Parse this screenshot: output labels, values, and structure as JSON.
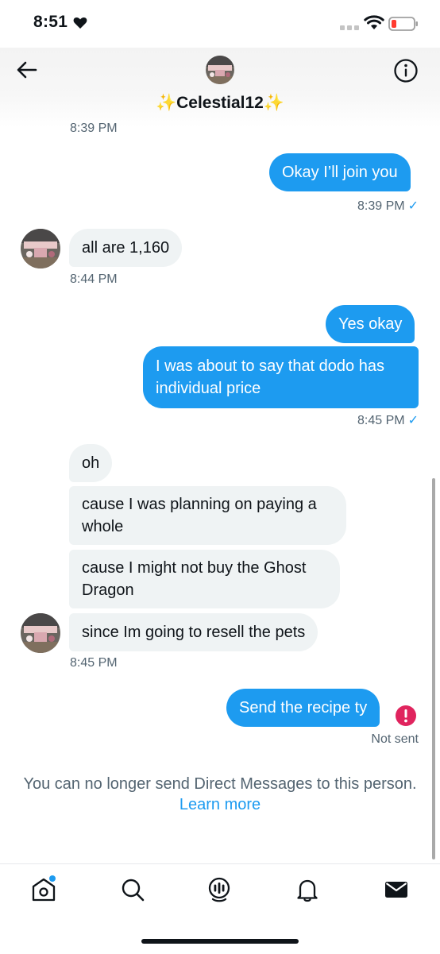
{
  "status_bar": {
    "time": "8:51"
  },
  "header": {
    "name": "✨Celestial12✨"
  },
  "messages": {
    "ts_top": "8:39 PM",
    "m1": {
      "text": "Okay I’ll join you",
      "ts": "8:39 PM"
    },
    "m2": {
      "text": "all are 1,160",
      "ts": "8:44 PM"
    },
    "m3": {
      "text": "Yes okay"
    },
    "m4": {
      "line1": "I was about to say that dodo has",
      "line2": "individual price",
      "ts": "8:45 PM"
    },
    "m5": {
      "text": "oh"
    },
    "m6": {
      "line1": "cause I was planning on paying a",
      "line2": "whole"
    },
    "m7": {
      "line1": "cause I might not buy the Ghost",
      "line2": "Dragon"
    },
    "m8": {
      "text": "since Im going to resell the pets",
      "ts": "8:45 PM"
    },
    "m9": {
      "text": "Send the recipe ty",
      "status": "Not sent"
    }
  },
  "check_mark": "✓",
  "notice": {
    "text": "You can no longer send Direct Messages to this person.",
    "link": "Learn more"
  },
  "tabs": [
    "home-icon",
    "search-icon",
    "spaces-icon",
    "notifications-icon",
    "messages-icon"
  ],
  "colors": {
    "accent": "#1d9bf0",
    "incoming_bubble": "#eff3f4",
    "error": "#e0245e",
    "muted_text": "#536471"
  }
}
